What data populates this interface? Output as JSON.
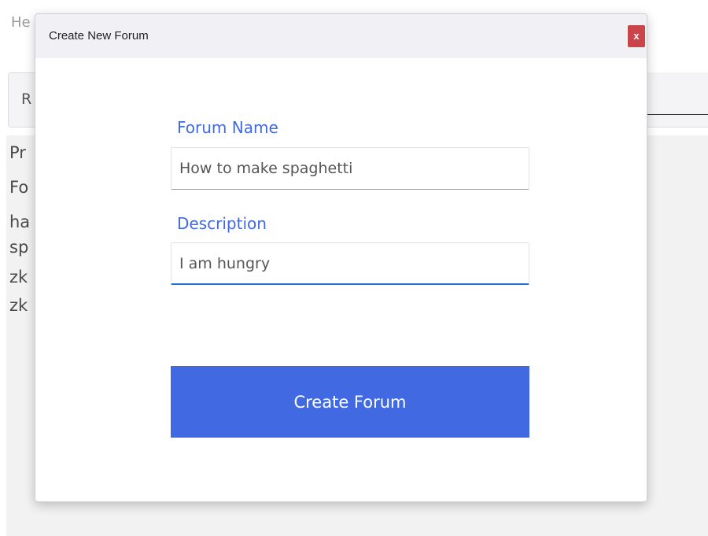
{
  "background": {
    "heading_partial": "He",
    "toolbar_button_partial": "R",
    "list_items_partial": [
      "Pr",
      "Fo",
      "ha",
      "sp",
      "zk",
      "zk"
    ]
  },
  "modal": {
    "title": "Create New Forum",
    "close_label": "x",
    "forum_name_label": "Forum Name",
    "forum_name_value": "How to make spaghetti",
    "description_label": "Description",
    "description_value": "I am hungry",
    "submit_label": "Create Forum"
  },
  "colors": {
    "accent": "#4169e1",
    "close_button": "#c9454a",
    "focus_underline": "#1f6fd0"
  }
}
